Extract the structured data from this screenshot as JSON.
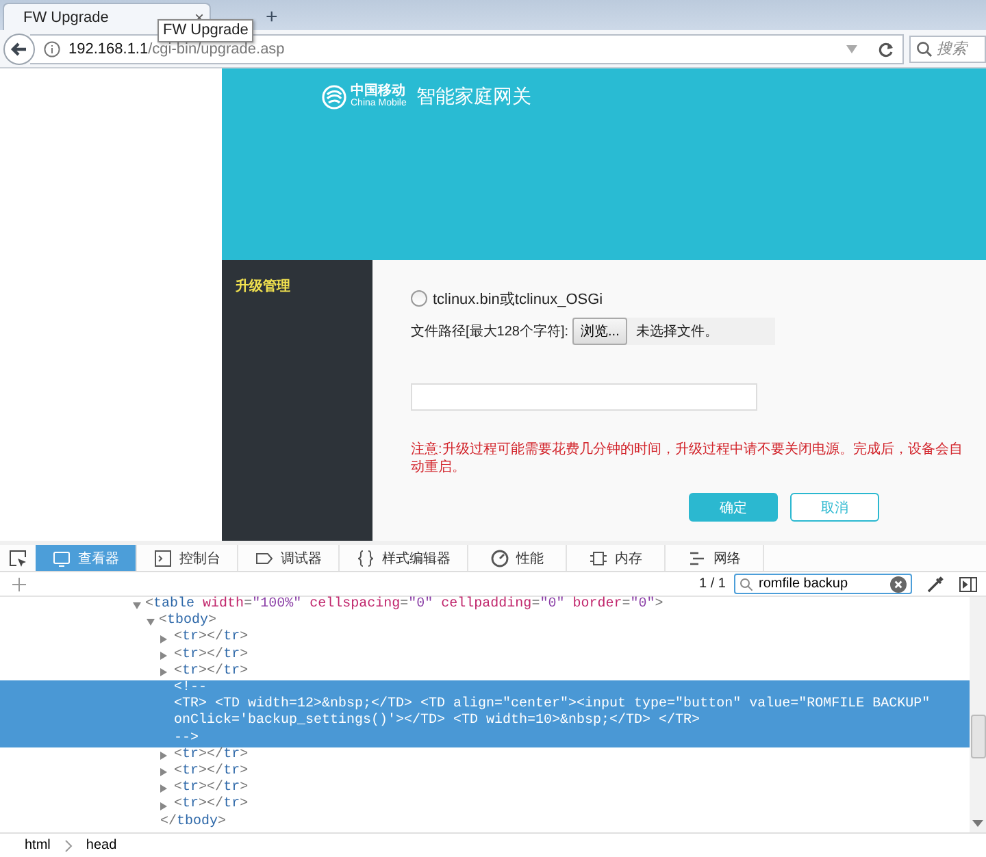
{
  "browser": {
    "tab": {
      "title": "FW Upgrade",
      "close": "×"
    },
    "new_tab": "+",
    "tooltip": "FW Upgrade",
    "address": {
      "host": "192.168.1.1",
      "path": "/cgi-bin/upgrade.asp"
    },
    "search": {
      "placeholder": "搜索"
    }
  },
  "page": {
    "brand": {
      "cn": "中国移动",
      "en": "China Mobile",
      "product": "智能家庭网关"
    },
    "sidebar": {
      "items": [
        {
          "label": "升级管理",
          "selected": true
        }
      ]
    },
    "form": {
      "option": {
        "label": "tclinux.bin或tclinux_OSGi",
        "checked": false
      },
      "file": {
        "label": "文件路径[最大128个字符]:",
        "button": "浏览...",
        "status": "未选择文件。"
      },
      "note": "注意:升级过程可能需要花费几分钟的时间，升级过程中请不要关闭电源。完成后，设备会自动重启。",
      "buttons": [
        {
          "label": "确定",
          "kind": "primary"
        },
        {
          "label": "取消",
          "kind": "secondary"
        }
      ]
    }
  },
  "devtools": {
    "tabs": [
      {
        "label": "查看器",
        "kind": "inspector",
        "selected": true
      },
      {
        "label": "控制台",
        "kind": "console",
        "selected": false
      },
      {
        "label": "调试器",
        "kind": "debugger",
        "selected": false
      },
      {
        "label": "样式编辑器",
        "kind": "style",
        "selected": false
      },
      {
        "label": "性能",
        "kind": "performance",
        "selected": false
      },
      {
        "label": "内存",
        "kind": "memory",
        "selected": false
      },
      {
        "label": "网络",
        "kind": "network",
        "selected": false
      }
    ],
    "search": {
      "count": "1 / 1",
      "value": "romfile backup"
    },
    "markup": [
      {
        "kind": "element",
        "text": "<table width=\"100%\" cellspacing=\"0\" cellpadding=\"0\" border=\"0\">",
        "expanded": true,
        "selected": false,
        "children": [
          {
            "kind": "element",
            "text": "<tbody>",
            "expanded": true,
            "selected": false,
            "closing": "</tbody>",
            "children": [
              {
                "kind": "element",
                "text": "<tr></tr>",
                "expanded": false,
                "selected": false
              },
              {
                "kind": "element",
                "text": "<tr></tr>",
                "expanded": false,
                "selected": false
              },
              {
                "kind": "element",
                "text": "<tr></tr>",
                "expanded": false,
                "selected": false
              },
              {
                "kind": "comment",
                "lines": [
                  "<!--",
                  "<TR> <TD width=12>&nbsp;</TD> <TD align=\"center\"><input type=\"button\" value=\"ROMFILE BACKUP\"",
                  "onClick='backup_settings()'></TD> <TD width=10>&nbsp;</TD> </TR>",
                  "-->"
                ],
                "selected": true
              },
              {
                "kind": "element",
                "text": "<tr></tr>",
                "expanded": false,
                "selected": false
              },
              {
                "kind": "element",
                "text": "<tr></tr>",
                "expanded": false,
                "selected": false
              },
              {
                "kind": "element",
                "text": "<tr></tr>",
                "expanded": false,
                "selected": false
              },
              {
                "kind": "element",
                "text": "<tr></tr>",
                "expanded": false,
                "selected": false
              }
            ]
          }
        ]
      }
    ],
    "breadcrumbs": [
      "html",
      "head"
    ]
  }
}
